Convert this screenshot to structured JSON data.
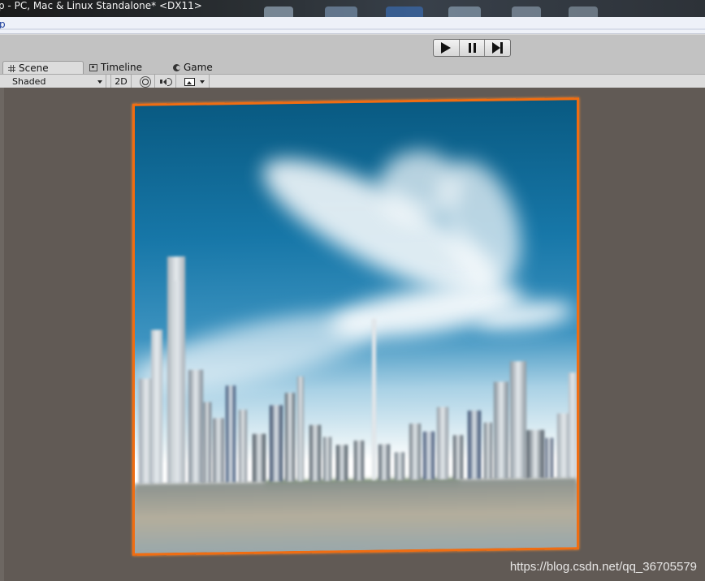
{
  "window": {
    "title": "p - PC, Mac & Linux Standalone* <DX11>"
  },
  "menu": {
    "first_item": "p"
  },
  "toolbar": {
    "play_icon": "play-icon",
    "pause_icon": "pause-icon",
    "step_icon": "step-icon"
  },
  "tabs": [
    {
      "label": "Scene",
      "icon": "grid-icon",
      "active": true
    },
    {
      "label": "Timeline",
      "icon": "timeline-icon",
      "active": false
    },
    {
      "label": "Game",
      "icon": "game-icon",
      "active": false
    }
  ],
  "scene_toolbar": {
    "draw_mode": "Shaded",
    "mode_2d": "2D",
    "lighting_icon": "sun-icon",
    "audio_icon": "speaker-icon",
    "effects_icon": "image-icon"
  },
  "viewport": {
    "selection_color": "#f06d12",
    "background_color": "#615a55"
  },
  "watermark": "https://blog.csdn.net/qq_36705579"
}
